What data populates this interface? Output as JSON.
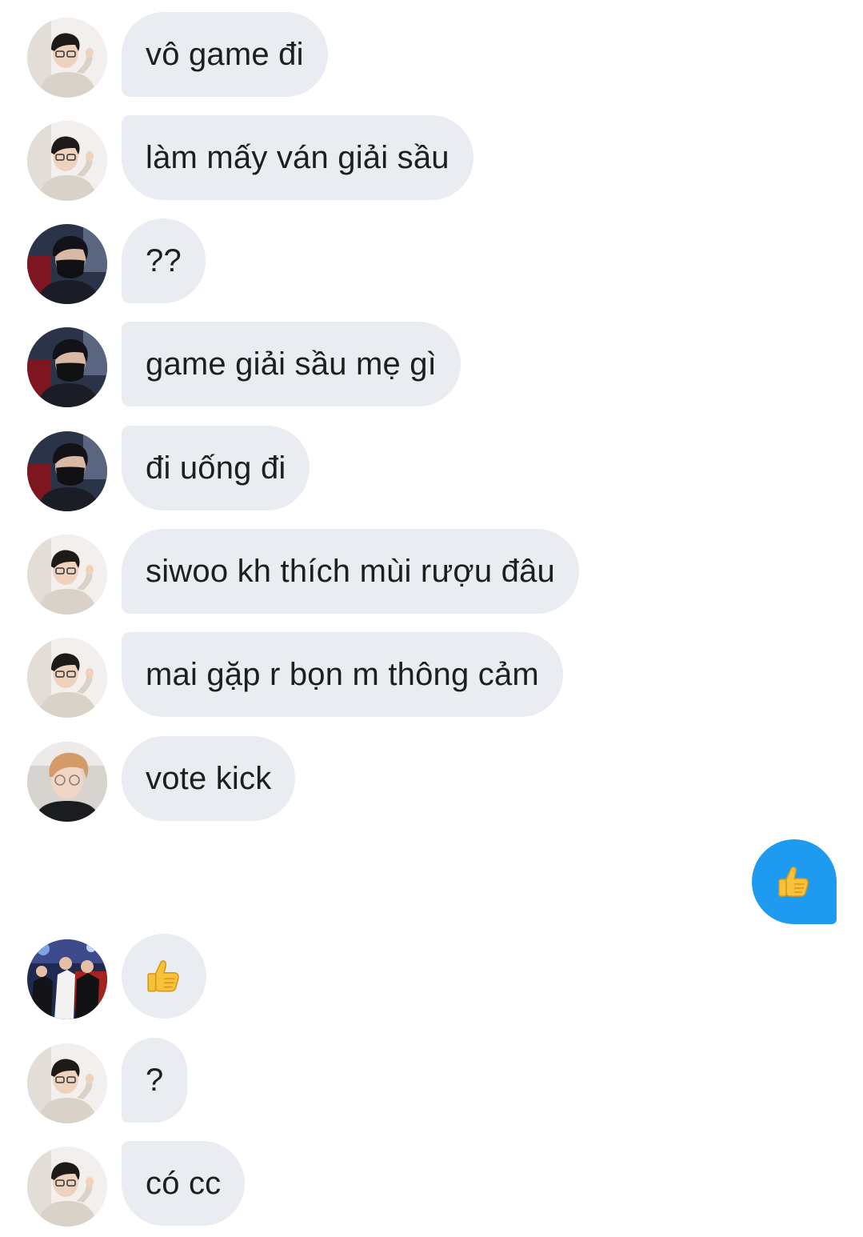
{
  "conversation": {
    "messages": [
      {
        "sender": "user-a",
        "text": "vô game đi"
      },
      {
        "sender": "user-a",
        "text": "làm mấy ván giải sầu"
      },
      {
        "sender": "user-b",
        "text": "??"
      },
      {
        "sender": "user-b",
        "text": "game giải sầu mẹ gì"
      },
      {
        "sender": "user-b",
        "text": "đi uống đi"
      },
      {
        "sender": "user-a",
        "text": "siwoo kh thích mùi rượu đâu"
      },
      {
        "sender": "user-a",
        "text": "mai gặp r bọn m thông cảm"
      },
      {
        "sender": "user-c",
        "text": "vote kick"
      },
      {
        "sender": "me",
        "emoji": "thumbs-up-icon"
      },
      {
        "sender": "user-d",
        "emoji": "thumbs-up-icon"
      },
      {
        "sender": "user-a",
        "text": "?"
      },
      {
        "sender": "user-a",
        "text": "có cc"
      }
    ]
  },
  "colors": {
    "incoming_bubble": "#e9ecf0",
    "outgoing_bubble": "#1e9bf0",
    "text": "#1c1e21"
  }
}
